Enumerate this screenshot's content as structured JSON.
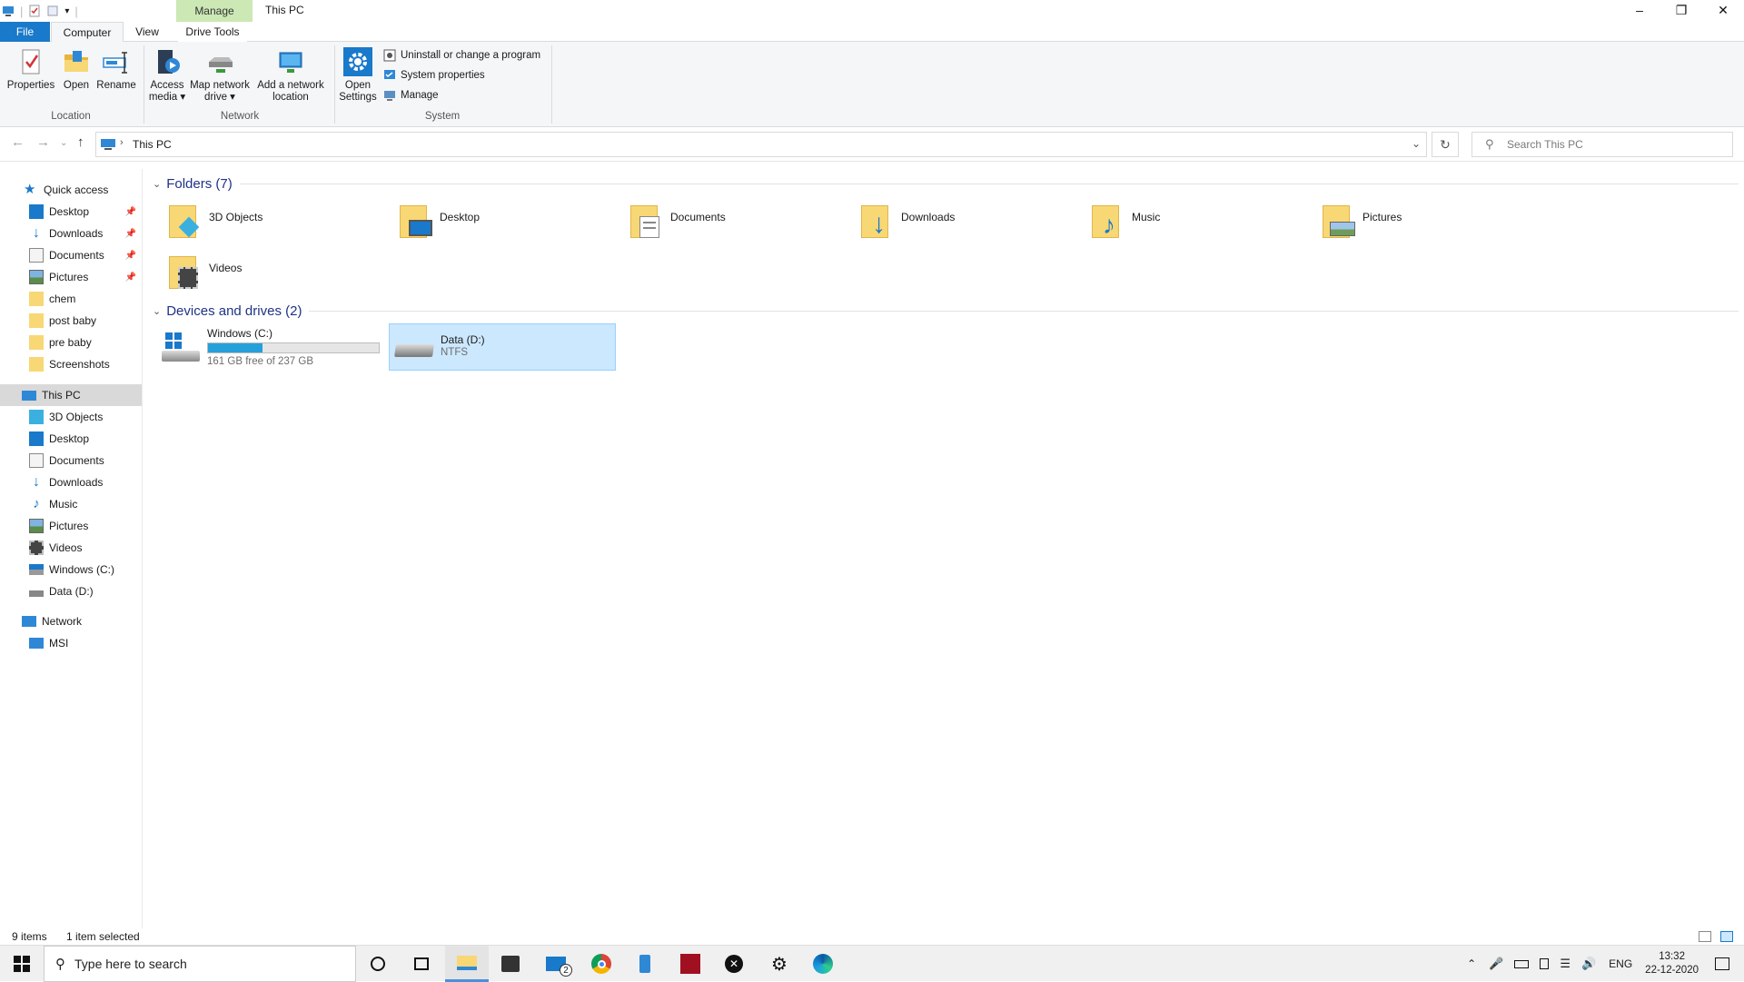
{
  "window": {
    "title": "This PC",
    "context_tab": "Manage"
  },
  "ribbon": {
    "tabs": [
      "File",
      "Computer",
      "View",
      "Drive Tools"
    ],
    "location": {
      "label": "Location",
      "buttons": [
        "Properties",
        "Open",
        "Rename"
      ]
    },
    "network": {
      "label": "Network",
      "access_media": [
        "Access",
        "media"
      ],
      "map_drive": [
        "Map network",
        "drive"
      ],
      "add_location": [
        "Add a network",
        "location"
      ]
    },
    "system": {
      "label": "System",
      "open_settings": [
        "Open",
        "Settings"
      ],
      "small": [
        "Uninstall or change a program",
        "System properties",
        "Manage"
      ]
    }
  },
  "address": {
    "path": "This PC",
    "search_placeholder": "Search This PC"
  },
  "sidebar": {
    "quick_access": "Quick access",
    "quick_items": [
      {
        "label": "Desktop",
        "pinned": true
      },
      {
        "label": "Downloads",
        "pinned": true
      },
      {
        "label": "Documents",
        "pinned": true
      },
      {
        "label": "Pictures",
        "pinned": true
      },
      {
        "label": "chem",
        "pinned": false
      },
      {
        "label": "post baby",
        "pinned": false
      },
      {
        "label": "pre baby",
        "pinned": false
      },
      {
        "label": "Screenshots",
        "pinned": false
      }
    ],
    "this_pc": "This PC",
    "pc_items": [
      "3D Objects",
      "Desktop",
      "Documents",
      "Downloads",
      "Music",
      "Pictures",
      "Videos",
      "Windows (C:)",
      "Data (D:)"
    ],
    "network": "Network",
    "network_items": [
      "MSI"
    ]
  },
  "content": {
    "folders_header": "Folders (7)",
    "folders": [
      "3D Objects",
      "Desktop",
      "Documents",
      "Downloads",
      "Music",
      "Pictures",
      "Videos"
    ],
    "drives_header": "Devices and drives (2)",
    "drives": [
      {
        "name": "Windows (C:)",
        "detail": "161 GB free of 237 GB",
        "used_fraction": 0.32,
        "selected": false
      },
      {
        "name": "Data (D:)",
        "detail": "NTFS",
        "selected": true
      }
    ]
  },
  "status": {
    "items": "9 items",
    "selected": "1 item selected"
  },
  "taskbar": {
    "search_placeholder": "Type here to search",
    "mail_badge": "2",
    "tray": {
      "lang": "ENG",
      "time": "13:32",
      "date": "22-12-2020"
    }
  },
  "colors": {
    "accent": "#1979ca",
    "context_tab": "#cce8b5",
    "selection": "#cce8ff",
    "folder": "#f8d775",
    "drive_bar": "#26a0da"
  }
}
